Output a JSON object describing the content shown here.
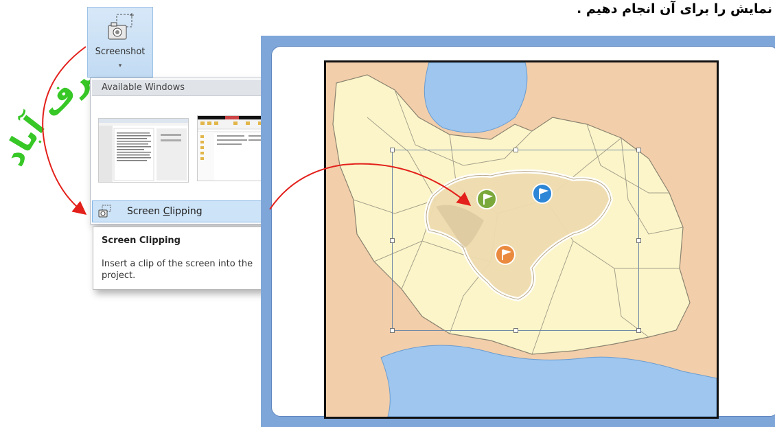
{
  "heading": "نمایش را برای آن انجام دهیم .",
  "watermark": "هنرستان شرف آباد",
  "ribbon": {
    "screenshot_label": "Screenshot",
    "caret": "▾"
  },
  "dropdown": {
    "header": "Available Windows",
    "screen_clipping_label": "Screen Clipping",
    "screen_clipping_mnemonic": "C"
  },
  "tooltip": {
    "title": "Screen Clipping",
    "body": "Insert a clip of the screen into the project."
  },
  "map": {
    "markers": [
      {
        "name": "green-flag",
        "color": "#7aa83a"
      },
      {
        "name": "blue-flag",
        "color": "#2d86d6"
      },
      {
        "name": "orange-flag",
        "color": "#ea8a3f"
      }
    ]
  },
  "colors": {
    "accent_arrow": "#e3201b",
    "watermark": "#22c20f",
    "sea": "#9ec6ee",
    "land": "#fbf5c9",
    "outside": "#f2ceaa"
  }
}
